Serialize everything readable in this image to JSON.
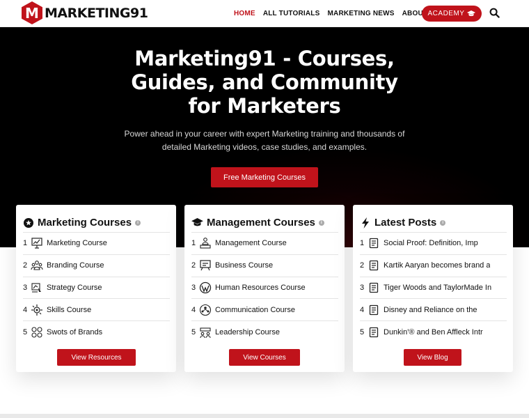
{
  "brand": {
    "logo_letter": "M",
    "name": "MARKETING91",
    "accent": "#c0131b"
  },
  "nav": {
    "items": [
      {
        "label": "HOME",
        "active": true
      },
      {
        "label": "ALL TUTORIALS"
      },
      {
        "label": "MARKETING NEWS"
      },
      {
        "label": "ABOUT US"
      }
    ],
    "academy_label": "ACADEMY"
  },
  "hero": {
    "title": "Marketing91 - Courses, Guides, and Community for Marketers",
    "subtitle": "Power ahead in your career with expert Marketing training and thousands of detailed Marketing videos, case studies, and examples.",
    "cta": "Free Marketing Courses"
  },
  "cards": [
    {
      "title": "Marketing Courses",
      "title_icon": "star-circle-icon",
      "items": [
        {
          "num": "1",
          "label": "Marketing Course",
          "icon": "presentation-icon"
        },
        {
          "num": "2",
          "label": "Branding Course",
          "icon": "team-icon"
        },
        {
          "num": "3",
          "label": "Strategy Course",
          "icon": "strategy-icon"
        },
        {
          "num": "4",
          "label": "Skills Course",
          "icon": "skills-icon"
        },
        {
          "num": "5",
          "label": "Swots of Brands",
          "icon": "swot-icon"
        }
      ],
      "button": "View Resources"
    },
    {
      "title": "Management Courses",
      "title_icon": "graduation-cap-icon",
      "items": [
        {
          "num": "1",
          "label": "Management Course",
          "icon": "manager-icon"
        },
        {
          "num": "2",
          "label": "Business Course",
          "icon": "business-board-icon"
        },
        {
          "num": "3",
          "label": "Human Resources Course",
          "icon": "wordpress-icon"
        },
        {
          "num": "4",
          "label": "Communication Course",
          "icon": "communication-icon"
        },
        {
          "num": "5",
          "label": "Leadership Course",
          "icon": "leadership-icon"
        }
      ],
      "button": "View Courses"
    },
    {
      "title": "Latest Posts",
      "title_icon": "bolt-icon",
      "items": [
        {
          "num": "1",
          "label": "Social Proof: Definition, Imp",
          "icon": "document-icon"
        },
        {
          "num": "2",
          "label": "Kartik Aaryan becomes brand a",
          "icon": "document-icon"
        },
        {
          "num": "3",
          "label": "Tiger Woods and TaylorMade In",
          "icon": "document-icon"
        },
        {
          "num": "4",
          "label": "Disney and Reliance on the",
          "icon": "document-icon"
        },
        {
          "num": "5",
          "label": "Dunkin'® and Ben Affleck Intr",
          "icon": "document-icon"
        }
      ],
      "button": "View Blog"
    }
  ]
}
